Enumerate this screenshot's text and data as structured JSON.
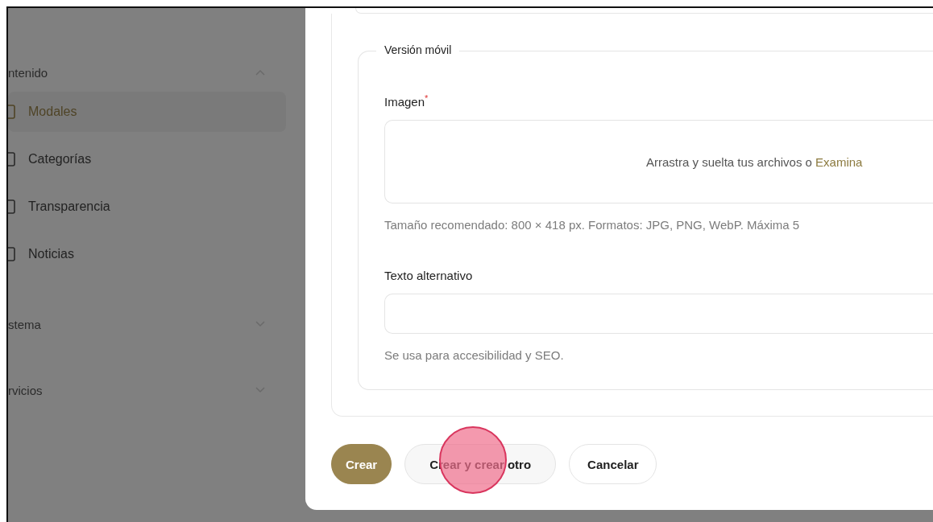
{
  "sidebar": {
    "groups": [
      {
        "label": "ntenido",
        "expanded": true,
        "items": [
          {
            "label": "Modales",
            "selected": true
          },
          {
            "label": "Categorías",
            "selected": false
          },
          {
            "label": "Transparencia",
            "selected": false
          },
          {
            "label": "Noticias",
            "selected": false
          }
        ]
      },
      {
        "label": "stema",
        "expanded": false
      },
      {
        "label": "rvicios",
        "expanded": false
      }
    ]
  },
  "modal": {
    "fieldset": {
      "legend": "Versión móvil",
      "image": {
        "label": "Imagen",
        "required": true,
        "required_mark": "*",
        "drop_text": "Arrastra y suelta tus archivos o ",
        "browse_link": "Examina",
        "hint": "Tamaño recomendado: 800 × 418 px. Formatos: JPG, PNG, WebP. Máxima 5"
      },
      "alt_text": {
        "label": "Texto alternativo",
        "hint": "Se usa para accesibilidad y SEO."
      }
    },
    "buttons": [
      {
        "label": "Crear",
        "kind": "primary"
      },
      {
        "label": "Crear y crear otro",
        "kind": "secondary"
      },
      {
        "label": "Cancelar",
        "kind": "plain"
      }
    ]
  }
}
